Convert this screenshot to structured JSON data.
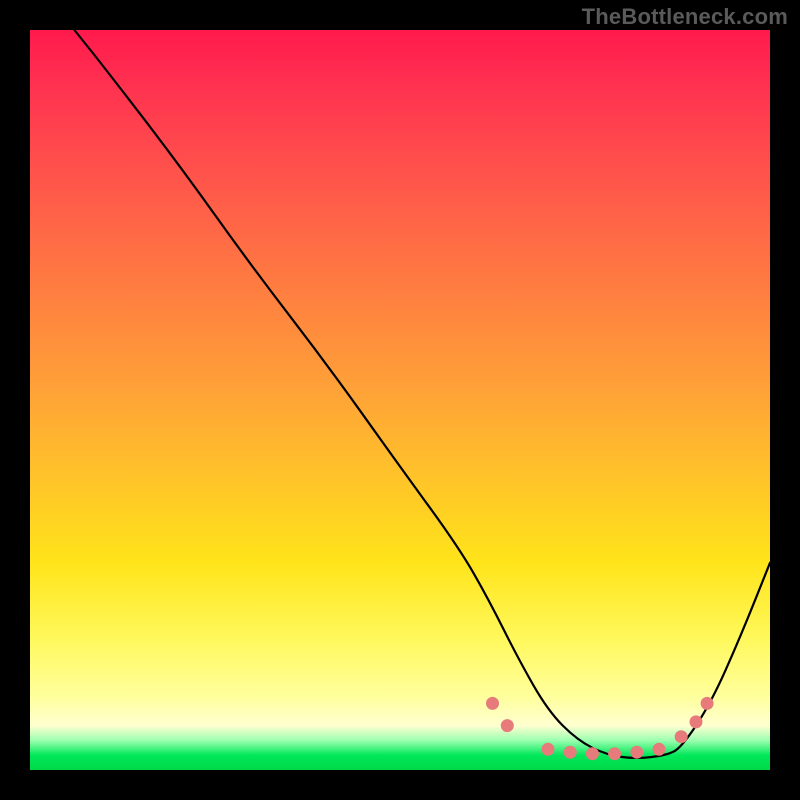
{
  "watermark": "TheBottleneck.com",
  "chart_data": {
    "type": "line",
    "title": "",
    "xlabel": "",
    "ylabel": "",
    "xlim": [
      0,
      100
    ],
    "ylim": [
      0,
      100
    ],
    "grid": false,
    "legend": false,
    "series": [
      {
        "name": "curve",
        "color": "#000000",
        "x": [
          6,
          10,
          20,
          30,
          40,
          50,
          58,
          62,
          66,
          70,
          74,
          78,
          82,
          86,
          88,
          92,
          96,
          100
        ],
        "y": [
          100,
          95,
          82,
          68,
          55,
          41,
          30,
          23,
          15,
          8,
          4,
          2,
          1.5,
          2,
          3,
          9,
          18,
          28
        ]
      }
    ],
    "markers": [
      {
        "x": 62.5,
        "y": 9.0
      },
      {
        "x": 64.5,
        "y": 6.0
      },
      {
        "x": 70.0,
        "y": 2.8
      },
      {
        "x": 73.0,
        "y": 2.4
      },
      {
        "x": 76.0,
        "y": 2.2
      },
      {
        "x": 79.0,
        "y": 2.2
      },
      {
        "x": 82.0,
        "y": 2.4
      },
      {
        "x": 85.0,
        "y": 2.8
      },
      {
        "x": 88.0,
        "y": 4.5
      },
      {
        "x": 90.0,
        "y": 6.5
      },
      {
        "x": 91.5,
        "y": 9.0
      }
    ],
    "marker_color": "#e77b7b",
    "green_band_y": 3
  }
}
